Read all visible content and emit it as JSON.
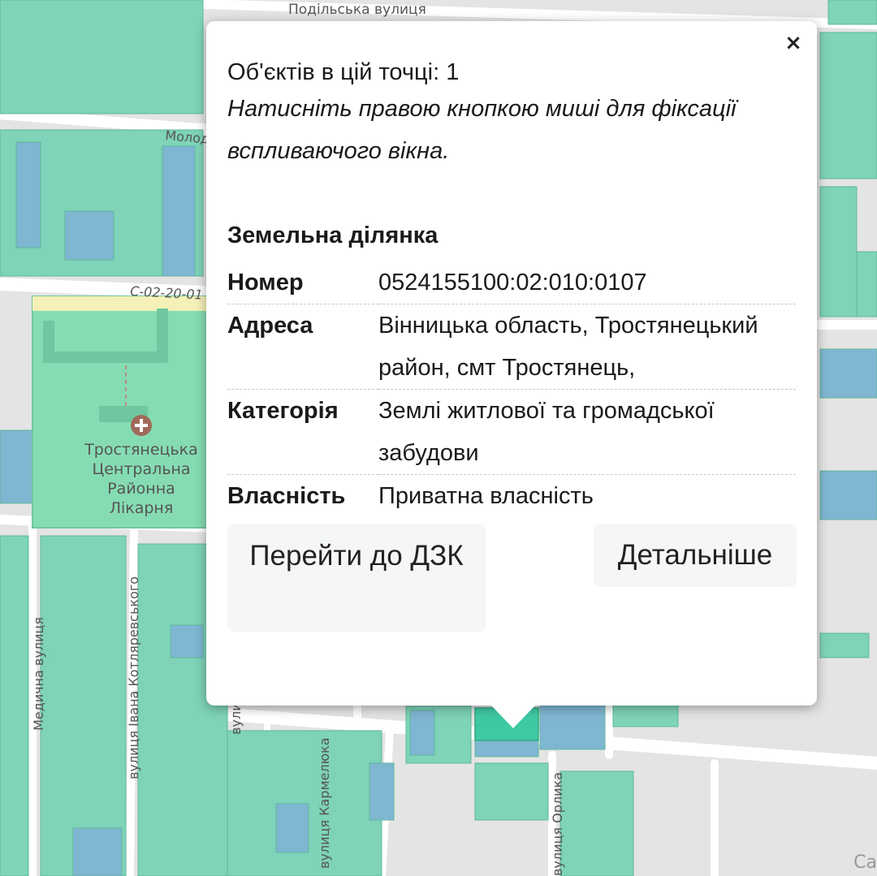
{
  "map": {
    "street_labels": {
      "podilska": "Подільська вулиця",
      "molod": "Молод",
      "road_code": "С-02-20-01",
      "medychna": "Медична вулиця",
      "kotliarevskoho": "вулиця Івана Котляревського",
      "vul": "вули",
      "karmeliuka": "вулиця Кармелюка",
      "orlyka": "вулиця Орлика"
    },
    "poi": {
      "icon": "hospital-cross-icon",
      "label_lines": [
        "Тростянецька",
        "Центральна",
        "Районна",
        "Лікарня"
      ]
    },
    "attribution": "Ca",
    "colors": {
      "parcel_green": "#7ed3b8",
      "parcel_blue": "#7fb6d2",
      "selected": "#3fc9a3",
      "hospital": "#86dcb2",
      "road": "#ffffff",
      "background": "#e4e4e4"
    }
  },
  "popup": {
    "close_label": "×",
    "count_text": "Об'єктів в цій точці: 1",
    "hint_text": "Натисніть правою кнопкою миші для фіксації вспливаючого вікна.",
    "section_title": "Земельна ділянка",
    "fields": [
      {
        "key": "Номер",
        "value": "0524155100:02:010:0107"
      },
      {
        "key": "Адреса",
        "value": "Вінницька область, Тростянецький район, смт Тростянець,"
      },
      {
        "key": "Категорія",
        "value": "Землі житлової та громадської забудови"
      },
      {
        "key": "Власність",
        "value": "Приватна власність"
      }
    ],
    "buttons": {
      "dzk": "Перейти до ДЗК",
      "more": "Детальніше"
    }
  }
}
